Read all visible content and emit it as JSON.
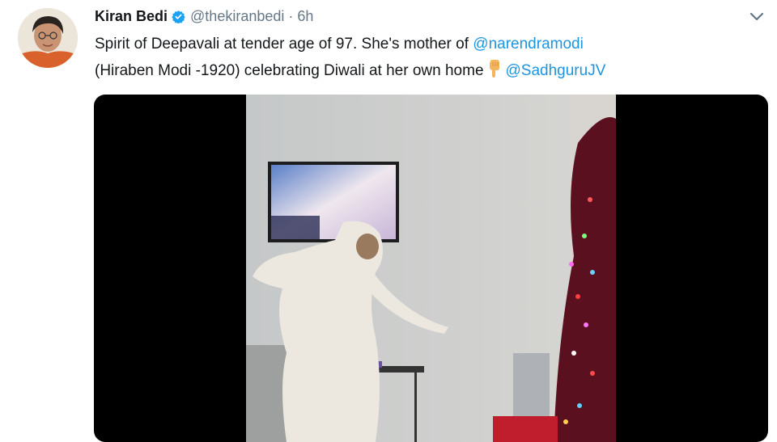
{
  "tweet": {
    "author_name": "Kiran Bedi",
    "handle": "@thekiranbedi",
    "separator": "·",
    "time": "6h",
    "text_line1_pre": "Spirit of Deepavali at tender age of 97. She's mother of ",
    "mention1": "@narendramodi",
    "text_line2_pre": "(Hiraben Modi -1920) celebrating Diwali at her own home",
    "mention2": "@SadhguruJV",
    "emoji": "point-down-hand"
  },
  "icons": {
    "verified": "verified-badge-icon",
    "menu": "chevron-down-icon"
  },
  "colors": {
    "link": "#1b95e0",
    "verified": "#1da1f2",
    "secondary_text": "#657786",
    "primary_text": "#14171a",
    "media_background": "#000000"
  }
}
